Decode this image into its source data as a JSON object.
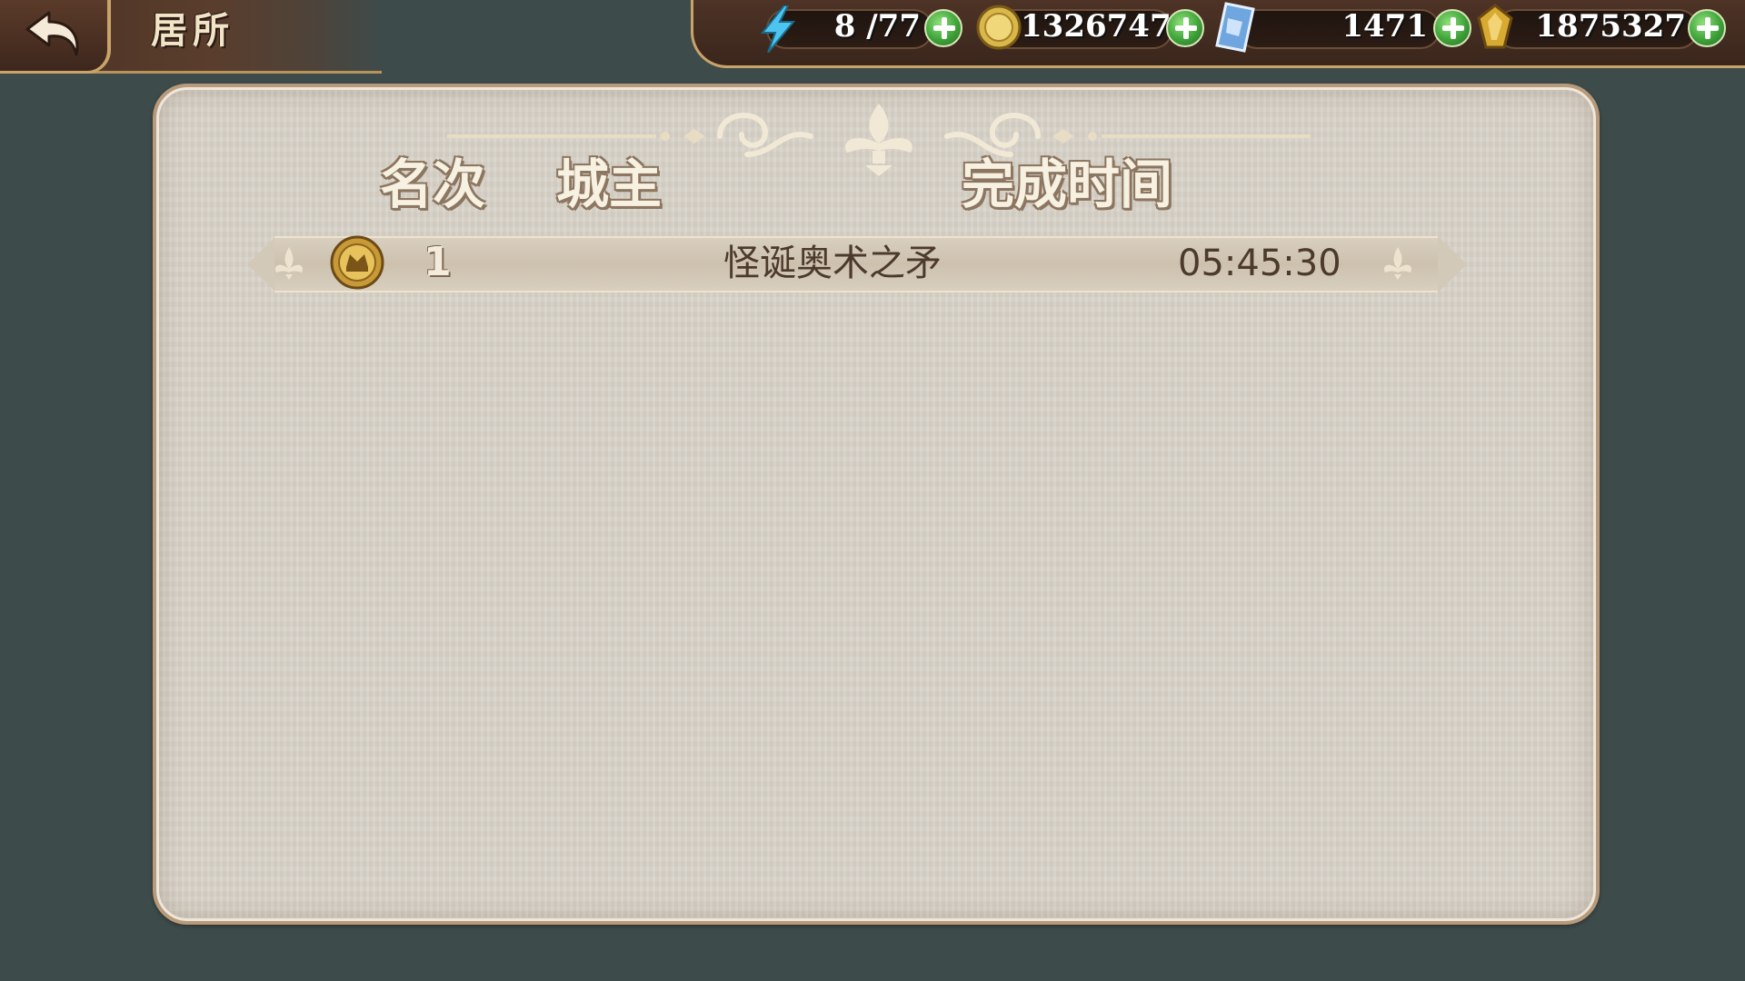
{
  "header": {
    "title": "居所"
  },
  "resources": {
    "energy": "8 /77",
    "gold": "1326747",
    "crystal": "1471",
    "gems": "1875327"
  },
  "table": {
    "columns": {
      "rank": "名次",
      "lord": "城主",
      "time": "完成时间"
    },
    "rows": [
      {
        "rank": "1",
        "lord": "怪诞奥术之矛",
        "time": "05:45:30"
      }
    ]
  },
  "colors": {
    "background": "#3e4b4b",
    "panel": "#d9d3c9",
    "bar_brown": "#4e3326",
    "gold_trim": "#c9a46a"
  }
}
